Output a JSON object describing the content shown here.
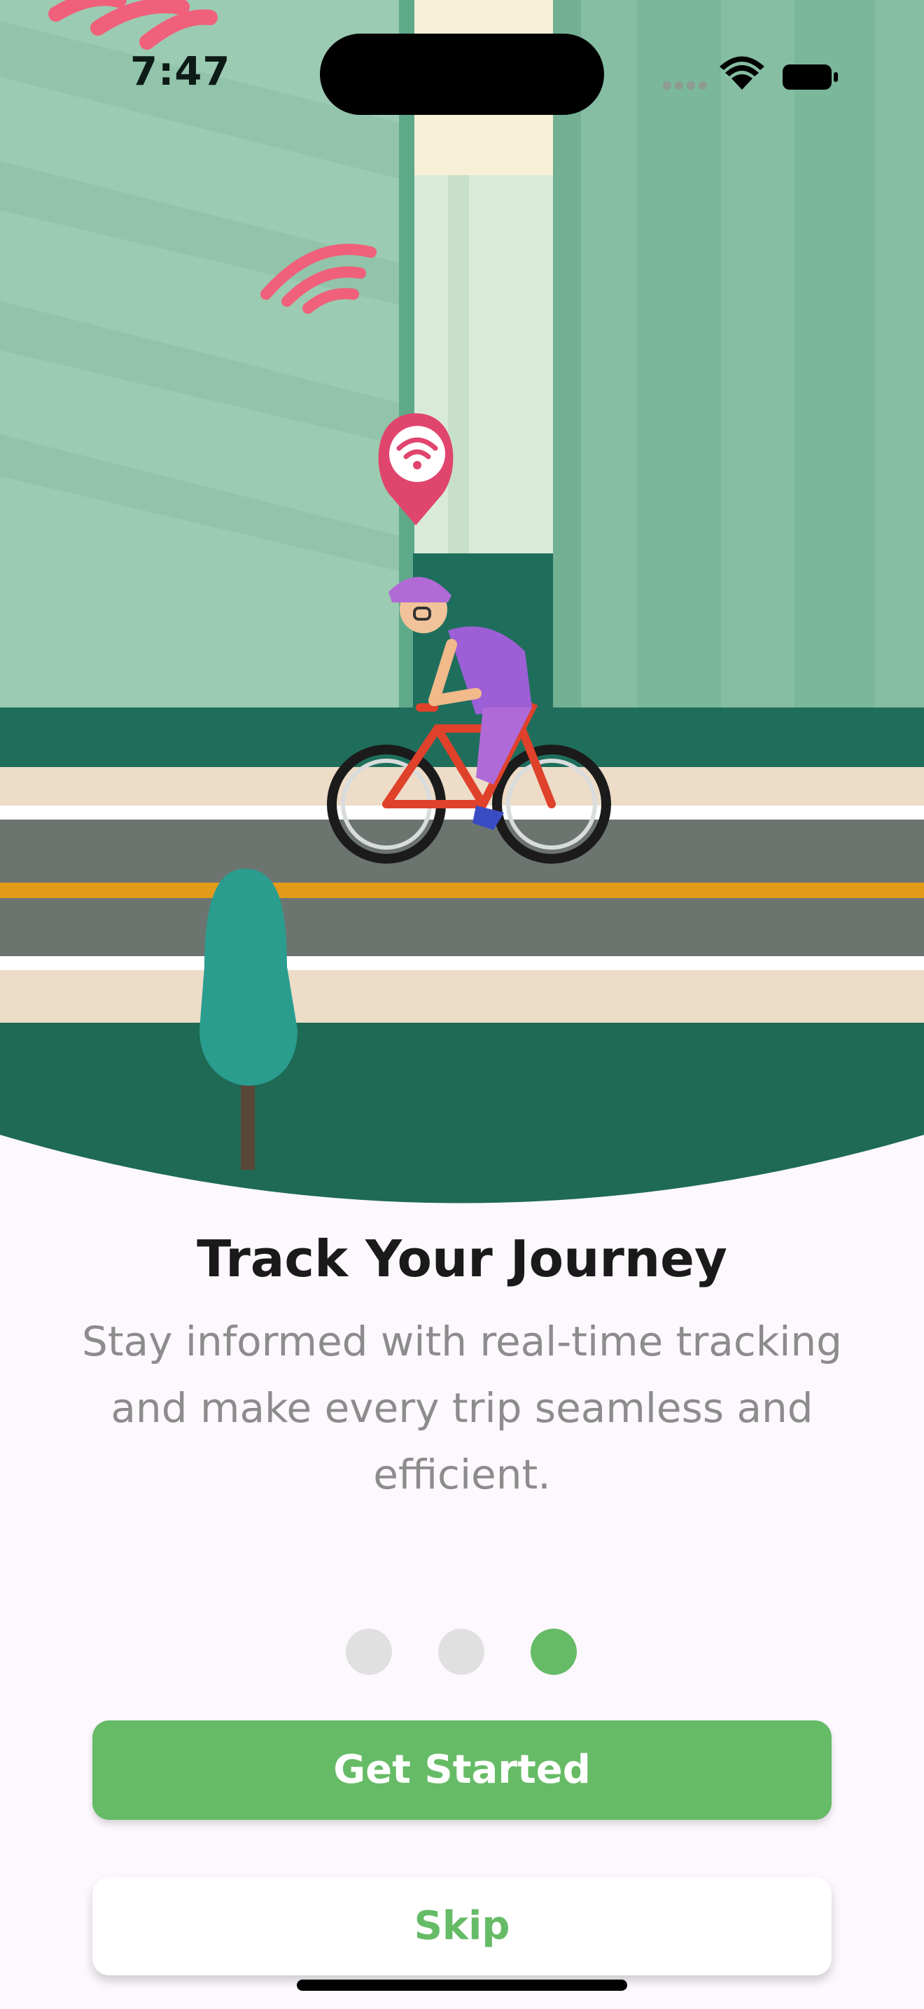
{
  "status_bar": {
    "time": "7:47"
  },
  "onboarding": {
    "title": "Track Your Journey",
    "description": "Stay informed with real-time tracking and make every trip seamless and efficient.",
    "page_count": 3,
    "current_page": 3
  },
  "actions": {
    "primary_label": "Get Started",
    "secondary_label": "Skip"
  },
  "colors": {
    "accent": "#66bb66",
    "background": "#fcf8fd",
    "hero_dark": "#1e6a54"
  },
  "icons": [
    "wifi-icon",
    "battery-icon",
    "signal-dots-icon",
    "location-pin-icon"
  ]
}
